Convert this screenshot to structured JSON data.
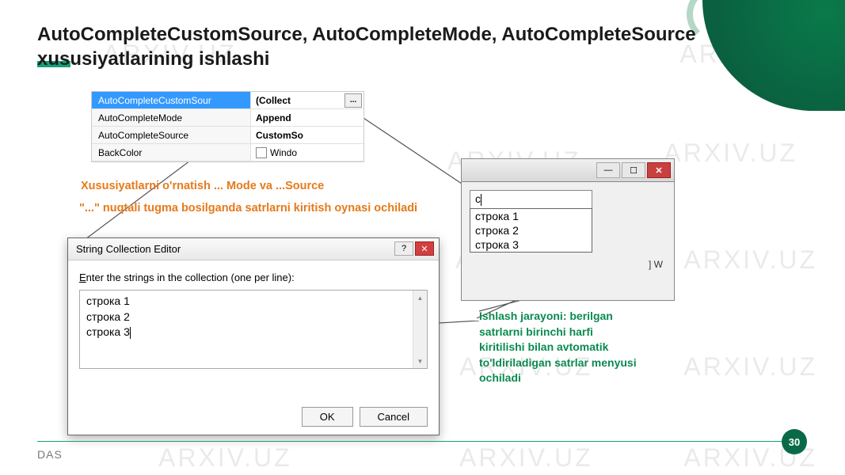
{
  "watermark": "ARXIV.UZ",
  "title": "AutoCompleteCustomSource, AutoCompleteMode, AutoCompleteSource xususiyatlarining ishlashi",
  "prop_grid": {
    "rows": [
      {
        "name": "AutoCompleteCustomSour",
        "value": "(Collect",
        "ellipsis": true,
        "selected": true
      },
      {
        "name": "AutoCompleteMode",
        "value": "Append"
      },
      {
        "name": "AutoCompleteSource",
        "value": "CustomSo"
      },
      {
        "name": "BackColor",
        "value": "Windo",
        "swatch": true
      }
    ]
  },
  "orange_text1": "Xususiyatlarni o'rnatish ... Mode va ...Source",
  "orange_text2": "\"...\" nuqtali tugma bosilganda satrlarni kiritish oynasi ochiladi",
  "editor": {
    "title": "String Collection Editor",
    "instruction": "Enter the strings in the collection (one per line):",
    "lines": [
      "строка 1",
      "строка 2",
      "строка 3"
    ],
    "ok": "OK",
    "cancel": "Cancel"
  },
  "autocomplete": {
    "input_value": "с",
    "items": [
      "строка 1",
      "строка 2",
      "строка 3"
    ],
    "status_frag": "] W"
  },
  "green_text": "Ishlash jarayoni: berilgan satrlarni birinchi harfi kiritilishi bilan avtomatik to'ldiriladigan satrlar menyusi ochiladi",
  "footer": "DAS",
  "page": "30"
}
